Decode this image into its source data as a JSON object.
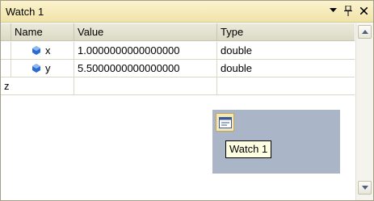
{
  "window": {
    "title": "Watch 1",
    "title_bg": "#f1e3a7",
    "icons": [
      "dropdown-arrow-icon",
      "pin-icon",
      "close-icon"
    ]
  },
  "grid": {
    "columns": [
      "Name",
      "Value",
      "Type"
    ],
    "rows": [
      {
        "name": "x",
        "value": "1.0000000000000000",
        "type": "double",
        "icon": "variable-field-icon"
      },
      {
        "name": "y",
        "value": "5.5000000000000000",
        "type": "double",
        "icon": "variable-field-icon"
      },
      {
        "name": "z",
        "value": "",
        "type": ""
      }
    ]
  },
  "dock_preview": {
    "tooltip": "Watch 1",
    "bg": "#aab6c8"
  }
}
